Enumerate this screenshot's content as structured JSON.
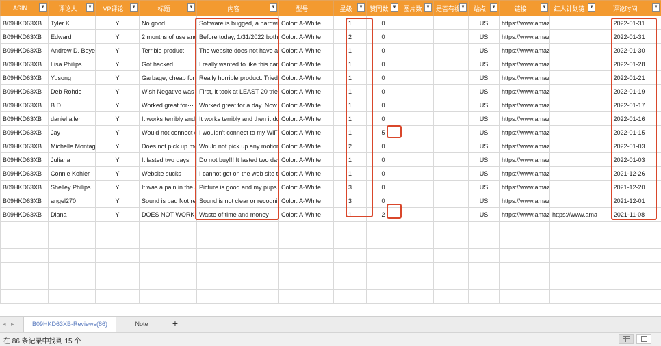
{
  "headers": [
    {
      "label": "ASIN",
      "filter": "▾"
    },
    {
      "label": "评论人",
      "filter": "▾"
    },
    {
      "label": "VP评论",
      "filter": "▾"
    },
    {
      "label": "标题",
      "filter": "▾"
    },
    {
      "label": "内容",
      "filter": "▾"
    },
    {
      "label": "型号",
      "filter": ""
    },
    {
      "label": "星级",
      "filter": "▾"
    },
    {
      "label": "赞同数",
      "filter": "▾"
    },
    {
      "label": "图片数",
      "filter": "▾"
    },
    {
      "label": "是否有视",
      "filter": "▾"
    },
    {
      "label": "站点",
      "filter": "▾"
    },
    {
      "label": "链接",
      "filter": "▾"
    },
    {
      "label": "红人计划链",
      "filter": "▾"
    },
    {
      "label": "评论时间",
      "filter": "▾"
    }
  ],
  "rows": [
    {
      "asin": "B09HKD63XB",
      "reviewer": "Tyler K.",
      "vp": "Y",
      "title": "No good",
      "content": "Software is bugged, a hardwir",
      "model": "Color: A-White",
      "stars": "1",
      "likes": "0",
      "images": "",
      "video": "",
      "site": "US",
      "link": "https://www.amazo",
      "influencer": "",
      "date": "2022-01-31"
    },
    {
      "asin": "B09HKD63XB",
      "reviewer": "Edward",
      "vp": "Y",
      "title": "2 months of use and",
      "content": "Before today, 1/31/2022 both",
      "model": "Color: A-White",
      "stars": "2",
      "likes": "0",
      "images": "",
      "video": "",
      "site": "US",
      "link": "https://www.amazo",
      "influencer": "",
      "date": "2022-01-31"
    },
    {
      "asin": "B09HKD63XB",
      "reviewer": "Andrew D. Beyer",
      "vp": "Y",
      "title": "Terrible product",
      "content": "The website does not have an",
      "model": "Color: A-White",
      "stars": "1",
      "likes": "0",
      "images": "",
      "video": "",
      "site": "US",
      "link": "https://www.amazo",
      "influencer": "",
      "date": "2022-01-30"
    },
    {
      "asin": "B09HKD63XB",
      "reviewer": "Lisa Philips",
      "vp": "Y",
      "title": "Got hacked",
      "content": "I really wanted to like this cam",
      "model": "Color: A-White",
      "stars": "1",
      "likes": "0",
      "images": "",
      "video": "",
      "site": "US",
      "link": "https://www.amazo",
      "influencer": "",
      "date": "2022-01-28"
    },
    {
      "asin": "B09HKD63XB",
      "reviewer": "Yusong",
      "vp": "Y",
      "title": "Garbage, cheap for a",
      "content": "Really horrible product. Tried t",
      "model": "Color: A-White",
      "stars": "1",
      "likes": "0",
      "images": "",
      "video": "",
      "site": "US",
      "link": "https://www.amazo",
      "influencer": "",
      "date": "2022-01-21"
    },
    {
      "asin": "B09HKD63XB",
      "reviewer": "Deb Rohde",
      "vp": "Y",
      "title": "Wish Negative was a",
      "content": "First, it took at LEAST 20 tries t",
      "model": "Color: A-White",
      "stars": "1",
      "likes": "0",
      "images": "",
      "video": "",
      "site": "US",
      "link": "https://www.amazo",
      "influencer": "",
      "date": "2022-01-19"
    },
    {
      "asin": "B09HKD63XB",
      "reviewer": "B.D.",
      "vp": "Y",
      "title": "Worked great for···",
      "content": "Worked great for a day. Now",
      "model": "Color: A-White",
      "stars": "1",
      "likes": "0",
      "images": "",
      "video": "",
      "site": "US",
      "link": "https://www.amazo",
      "influencer": "",
      "date": "2022-01-17"
    },
    {
      "asin": "B09HKD63XB",
      "reviewer": "daniel allen",
      "vp": "Y",
      "title": "It works terribly and i",
      "content": "It works terribly and then it do",
      "model": "Color: A-White",
      "stars": "1",
      "likes": "0",
      "images": "",
      "video": "",
      "site": "US",
      "link": "https://www.amazo",
      "influencer": "",
      "date": "2022-01-16"
    },
    {
      "asin": "B09HKD63XB",
      "reviewer": "Jay",
      "vp": "Y",
      "title": "Would not connect or",
      "content": "I wouldn't connect to my WiFi",
      "model": "Color: A-White",
      "stars": "1",
      "likes": "5",
      "images": "",
      "video": "",
      "site": "US",
      "link": "https://www.amazo",
      "influencer": "",
      "date": "2022-01-15"
    },
    {
      "asin": "B09HKD63XB",
      "reviewer": "Michelle Montag",
      "vp": "Y",
      "title": "Does not pick up mo",
      "content": "Would not pick up any motion",
      "model": "Color: A-White",
      "stars": "2",
      "likes": "0",
      "images": "",
      "video": "",
      "site": "US",
      "link": "https://www.amazo",
      "influencer": "",
      "date": "2022-01-03"
    },
    {
      "asin": "B09HKD63XB",
      "reviewer": "Juliana",
      "vp": "Y",
      "title": "It lasted two days",
      "content": "Do not buy!!! It lasted two day",
      "model": "Color: A-White",
      "stars": "1",
      "likes": "0",
      "images": "",
      "video": "",
      "site": "US",
      "link": "https://www.amazo",
      "influencer": "",
      "date": "2022-01-03"
    },
    {
      "asin": "B09HKD63XB",
      "reviewer": "Connie Kohler",
      "vp": "Y",
      "title": "Website sucks",
      "content": "I cannot get on the web site to",
      "model": "Color: A-White",
      "stars": "1",
      "likes": "0",
      "images": "",
      "video": "",
      "site": "US",
      "link": "https://www.amazo",
      "influencer": "",
      "date": "2021-12-26"
    },
    {
      "asin": "B09HKD63XB",
      "reviewer": "Shelley Philips",
      "vp": "Y",
      "title": "It was a pain in the a",
      "content": "Picture is good and my pups c",
      "model": "Color: A-White",
      "stars": "3",
      "likes": "0",
      "images": "",
      "video": "",
      "site": "US",
      "link": "https://www.amazo",
      "influencer": "",
      "date": "2021-12-20"
    },
    {
      "asin": "B09HKD63XB",
      "reviewer": "angel270",
      "vp": "Y",
      "title": "Sound is bad   Not re",
      "content": "Sound is not clear or recogniz",
      "model": "Color: A-White",
      "stars": "3",
      "likes": "0",
      "images": "",
      "video": "",
      "site": "US",
      "link": "https://www.amazo",
      "influencer": "",
      "date": "2021-12-01"
    },
    {
      "asin": "B09HKD63XB",
      "reviewer": "Diana",
      "vp": "Y",
      "title": "DOES NOT WORK",
      "content": "Waste of time and money",
      "model": "Color: A-White",
      "stars": "1",
      "likes": "2",
      "images": "",
      "video": "",
      "site": "US",
      "link": "https://www.amazo",
      "influencer": "https://www.ama",
      "date": "2021-11-08"
    }
  ],
  "empty_rows": 6,
  "tabs": {
    "prev": "◂",
    "next": "▸",
    "sheet1": "B09HKD63XB-Reviews(86)",
    "sheet2": "Note",
    "add": "+"
  },
  "status": {
    "text": "在 86 条记录中找到 15 个"
  },
  "colors": {
    "header": "#f39a30",
    "highlight": "#d9472b"
  }
}
